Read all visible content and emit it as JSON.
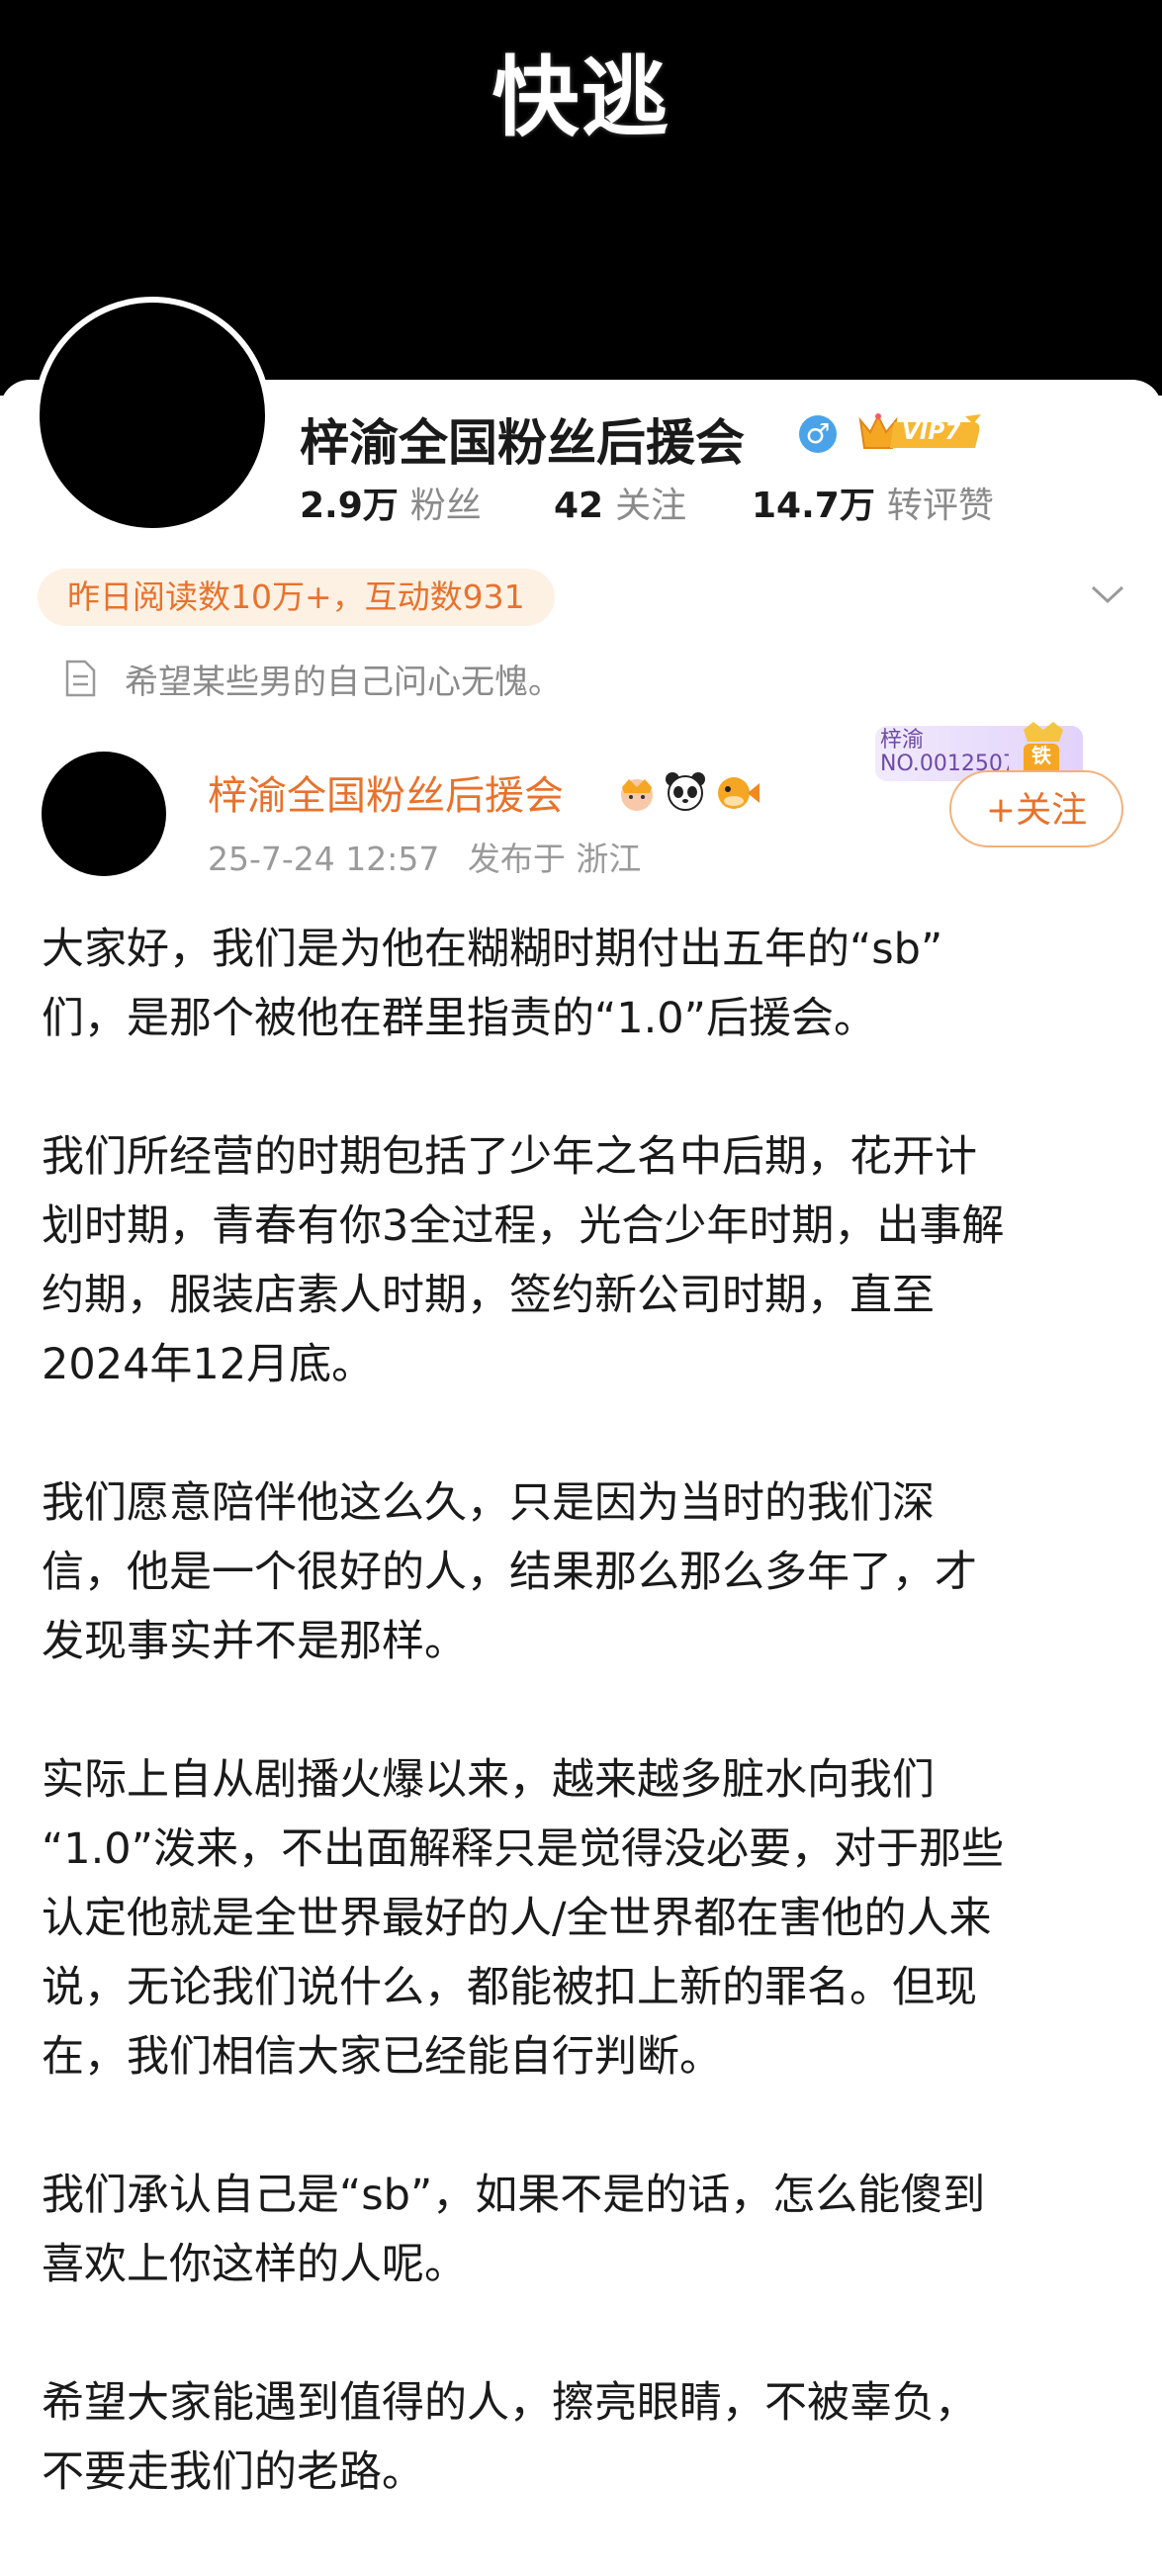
{
  "header": {
    "title": "快逃",
    "background": "#000000"
  },
  "profile": {
    "name": "梓渝全国粉丝后援会",
    "gender_icon": "male-icon",
    "vip_label": "VIP7",
    "stats": {
      "fans_value": "2.9万",
      "fans_label": "粉丝",
      "following_value": "42",
      "following_label": "关注",
      "interactions_value": "14.7万",
      "interactions_label": "转评赞"
    },
    "highlight": "昨日阅读数10万+，互动数931",
    "bio": "希望某些男的自己问心无愧。"
  },
  "post": {
    "author": "梓渝全国粉丝后援会",
    "time": "25-7-24 12:57",
    "location": "发布于 浙江",
    "fan_card_name": "梓渝",
    "fan_card_no": "NO.0012507",
    "fan_card_tag": "铁",
    "follow_label": "+关注",
    "paragraphs": [
      "大家好，我们是为他在糊糊时期付出五年的“sb”\n们，是那个被他在群里指责的“1.0”后援会。",
      "我们所经营的时期包括了少年之名中后期，花开计\n划时期，青春有你3全过程，光合少年时期，出事解\n约期，服装店素人时期，签约新公司时期，直至\n2024年12月底。",
      "我们愿意陪伴他这么久，只是因为当时的我们深\n信，他是一个很好的人，结果那么那么多年了，才\n发现事实并不是那样。",
      "实际上自从剧播火爆以来，越来越多脏水向我们\n“1.0”泼来，不出面解释只是觉得没必要，对于那些\n认定他就是全世界最好的人/全世界都在害他的人来\n说，无论我们说什么，都能被扣上新的罪名。但现\n在，我们相信大家已经能自行判断。",
      "我们承认自己是“sb”，如果不是的话，怎么能傻到\n喜欢上你这样的人呢。",
      "希望大家能遇到值得的人，擦亮眼睛，不被辜负，\n不要走我们的老路。"
    ]
  },
  "colors": {
    "accent": "#e8722c",
    "muted": "#8a8a8a",
    "gender": "#4aa3e8",
    "vip_gold": "#f5a623"
  }
}
